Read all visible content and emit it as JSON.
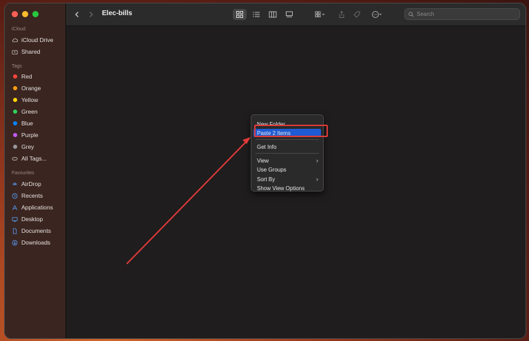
{
  "window": {
    "title": "Elec-bills"
  },
  "sidebar": {
    "sections": {
      "icloud": "iCloud",
      "tags": "Tags",
      "favourites": "Favourites"
    },
    "icloud_items": [
      {
        "label": "iCloud Drive",
        "icon": "cloud-icon"
      },
      {
        "label": "Shared",
        "icon": "shared-folder-icon"
      }
    ],
    "tags": [
      {
        "label": "Red",
        "color": "#ff453a"
      },
      {
        "label": "Orange",
        "color": "#ff9f0a"
      },
      {
        "label": "Yellow",
        "color": "#ffd60a"
      },
      {
        "label": "Green",
        "color": "#30d158"
      },
      {
        "label": "Blue",
        "color": "#0a84ff"
      },
      {
        "label": "Purple",
        "color": "#bf5af2"
      },
      {
        "label": "Grey",
        "color": "#98989d"
      },
      {
        "label": "All Tags...",
        "icon": "tag-outline-icon"
      }
    ],
    "favourites": [
      {
        "label": "AirDrop",
        "icon": "airdrop-icon"
      },
      {
        "label": "Recents",
        "icon": "clock-icon"
      },
      {
        "label": "Applications",
        "icon": "applications-icon"
      },
      {
        "label": "Desktop",
        "icon": "desktop-icon"
      },
      {
        "label": "Documents",
        "icon": "document-icon"
      },
      {
        "label": "Downloads",
        "icon": "download-icon"
      }
    ]
  },
  "search": {
    "placeholder": "Search"
  },
  "context_menu": {
    "items": [
      {
        "label": "New Folder"
      },
      {
        "label": "Paste 2 Items"
      },
      {
        "label": "Get Info"
      },
      {
        "label": "View"
      },
      {
        "label": "Use Groups"
      },
      {
        "label": "Sort By"
      },
      {
        "label": "Show View Options"
      }
    ]
  },
  "colors": {
    "annotation": "#e03a3a",
    "selection": "#1f5bd4"
  }
}
